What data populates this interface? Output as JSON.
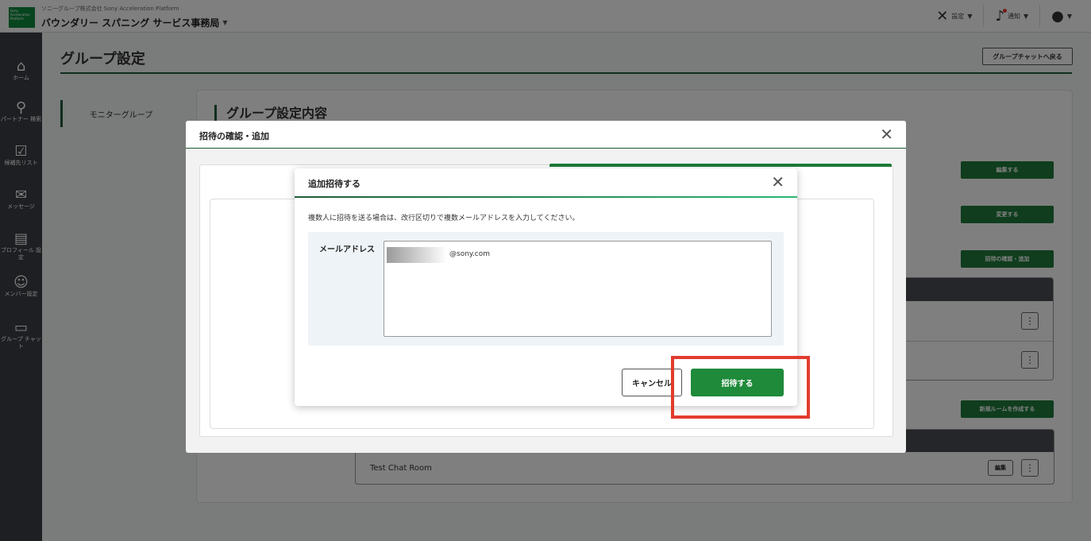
{
  "topbar": {
    "logo_text": "Sony Acceleration Platform",
    "company": "ソニーグループ株式会社 Sony Acceleration Platform",
    "team": "バウンダリー スパニング サービス事務局",
    "settings_label": "設定",
    "notify_label": "通知"
  },
  "rail": [
    {
      "label": "ホーム",
      "icon": "home-icon"
    },
    {
      "label": "パートナー 検索",
      "icon": "search-icon"
    },
    {
      "label": "候補先リスト",
      "icon": "checklist-icon"
    },
    {
      "label": "メッセージ",
      "icon": "mail-icon"
    },
    {
      "label": "プロフィール 設定",
      "icon": "profile-icon"
    },
    {
      "label": "メンバー設定",
      "icon": "members-icon"
    },
    {
      "label": "グループ チャット",
      "icon": "chat-icon"
    }
  ],
  "page": {
    "title": "グループ設定",
    "back_button": "グループチャットへ戻る",
    "side_tab": "モニターグループ",
    "panel_title": "グループ設定内容",
    "edit_button": "編集する",
    "change_button": "変更する",
    "invite_confirm_button": "招待の確認・追加",
    "new_room_button": "新規ルームを作成する",
    "room_name": "Test Chat Room",
    "room_edit": "編集",
    "kebab": "⋮"
  },
  "modal_outer": {
    "title": "招待の確認・追加",
    "close": "✕"
  },
  "modal_inner": {
    "title": "追加招待する",
    "close": "✕",
    "instruction": "複数人に招待を送る場合は、改行区切りで複数メールアドレスを入力してください。",
    "email_label": "メールアドレス",
    "email_value": "@sony.com",
    "cancel_button": "キャンセル",
    "invite_button": "招待する"
  },
  "colors": {
    "accent_green": "#1e8a3a",
    "highlight_red": "#e23b2e"
  }
}
